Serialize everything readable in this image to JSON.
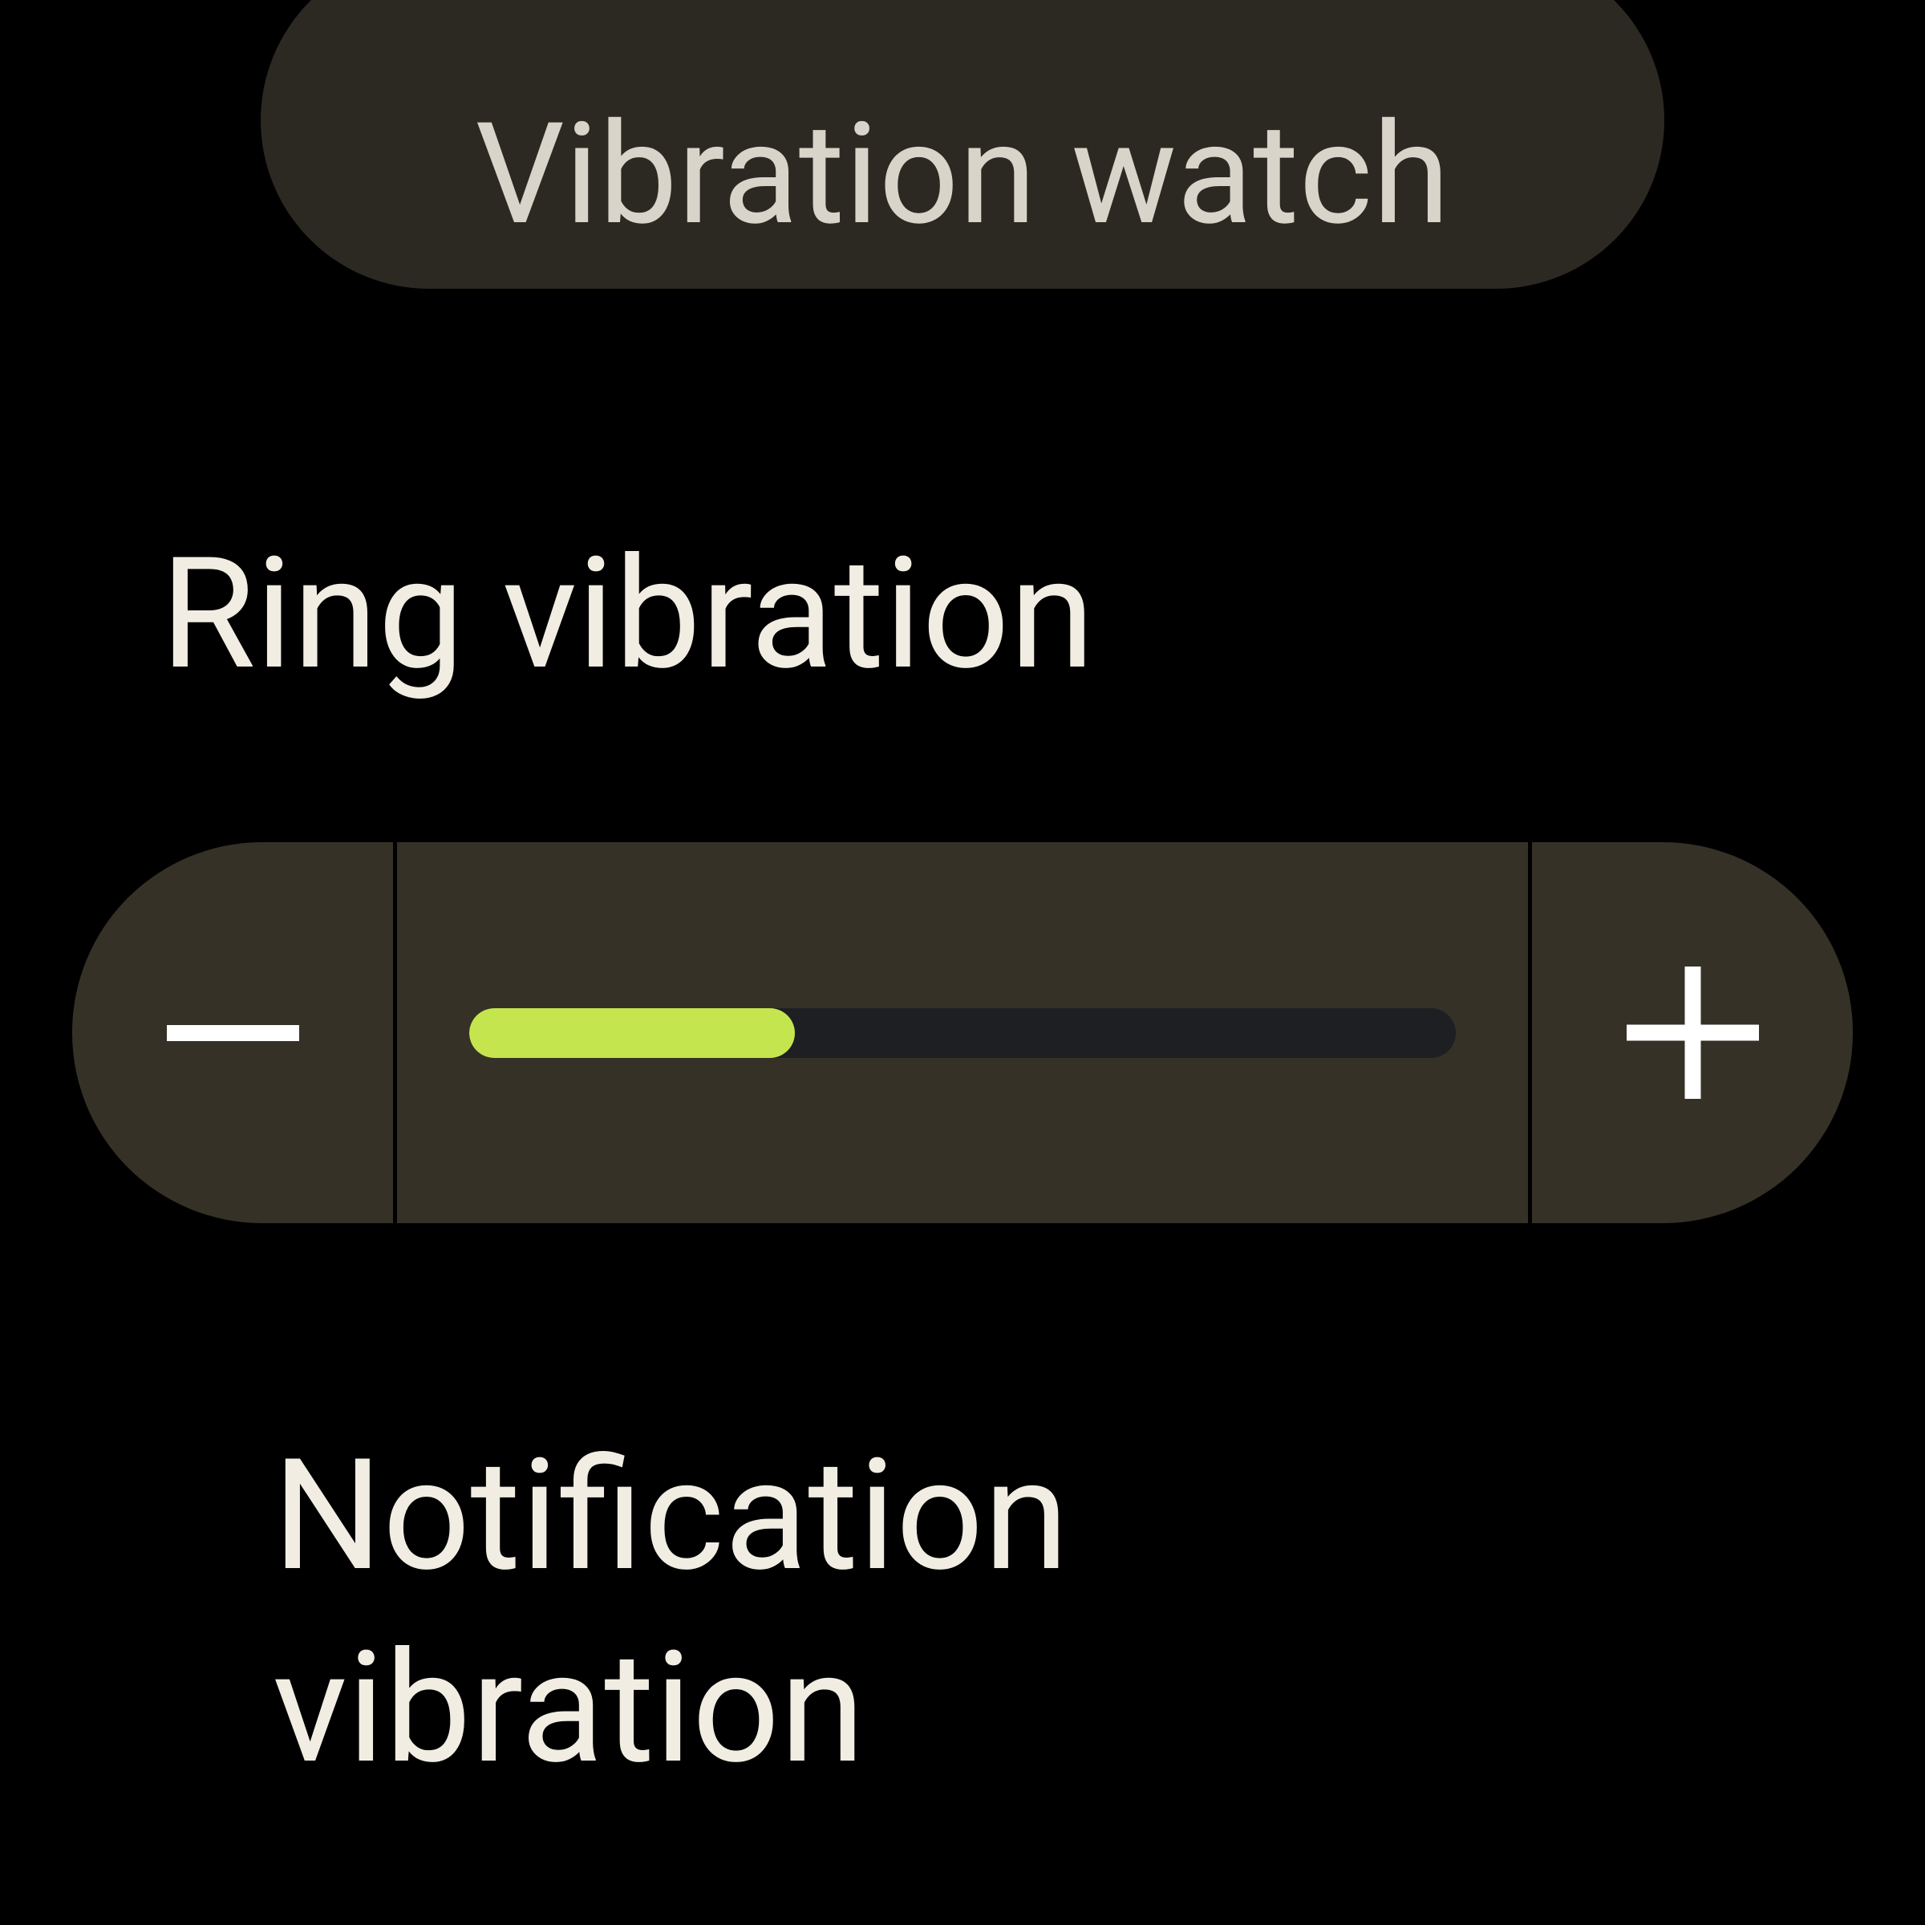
{
  "header": {
    "chip_label": "Vibration watch"
  },
  "ring": {
    "label": "Ring vibration",
    "value_percent": 33
  },
  "notification": {
    "label": "Notification vibration"
  },
  "colors": {
    "accent": "#c5e54e",
    "chip_bg": "#2c2923",
    "stepper_bg": "#363127",
    "track_bg": "#1d1f23",
    "text_primary": "#f1ede2",
    "text_secondary": "#d8d4c9"
  }
}
